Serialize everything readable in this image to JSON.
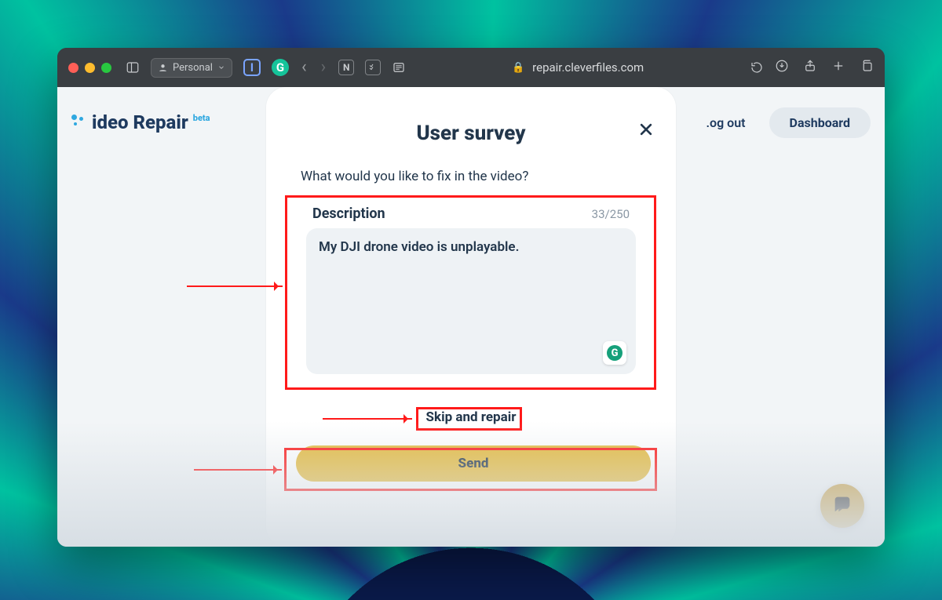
{
  "browser": {
    "profile_label": "Personal",
    "url_host": "repair.cleverfiles.com"
  },
  "header": {
    "logo_text": "ideo Repair",
    "logo_badge": "beta",
    "logout_label": ".og out",
    "dashboard_label": "Dashboard"
  },
  "modal": {
    "title": "User survey",
    "question": "What would you like to fix in the video?",
    "description_label": "Description",
    "char_counter": "33/250",
    "textarea_value": "My DJI drone video is unplayable.",
    "skip_label": "Skip and repair",
    "send_label": "Send"
  }
}
